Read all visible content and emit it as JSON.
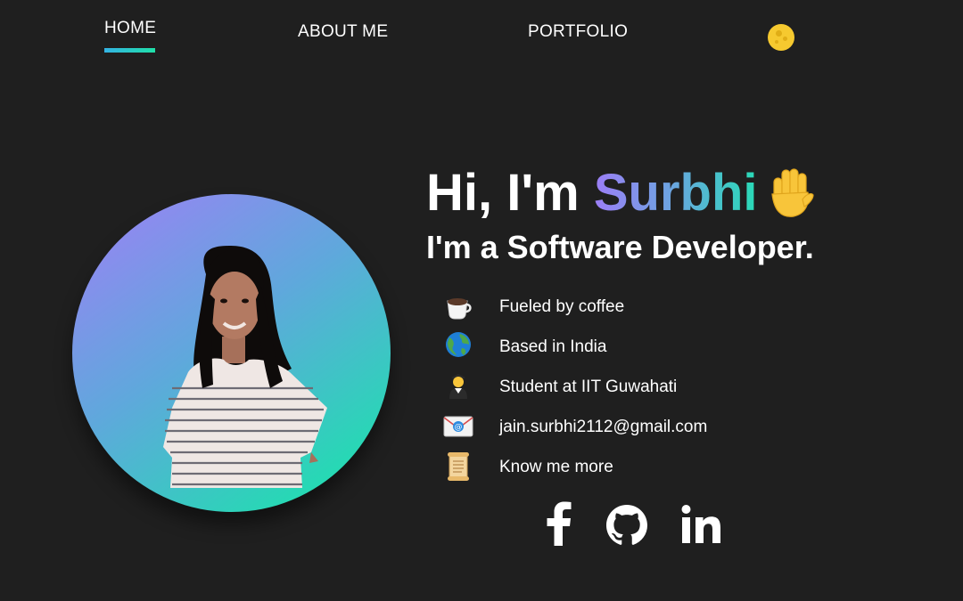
{
  "nav": {
    "home": "HOME",
    "about": "ABOUT ME",
    "portfolio": "PORTFOLIO",
    "theme_toggle_icon": "moon-icon"
  },
  "hero": {
    "greeting_prefix": "Hi, I'm ",
    "name": "Surbhi",
    "wave_icon": "waving-hand-icon",
    "role": "I'm a Software Developer."
  },
  "info": [
    {
      "icon": "coffee-cup-icon",
      "label": "Fueled by coffee"
    },
    {
      "icon": "globe-icon",
      "label": "Based in India"
    },
    {
      "icon": "student-icon",
      "label": "Student at IIT Guwahati"
    },
    {
      "icon": "envelope-icon",
      "label": "jain.surbhi2112@gmail.com"
    },
    {
      "icon": "scroll-icon",
      "label": "Know me more"
    }
  ],
  "social": [
    "facebook-icon",
    "github-icon",
    "linkedin-icon"
  ],
  "colors": {
    "background": "#1f1f1f",
    "accent_start": "#9c7ef6",
    "accent_end": "#12eaa6",
    "moon": "#f6c92f"
  }
}
